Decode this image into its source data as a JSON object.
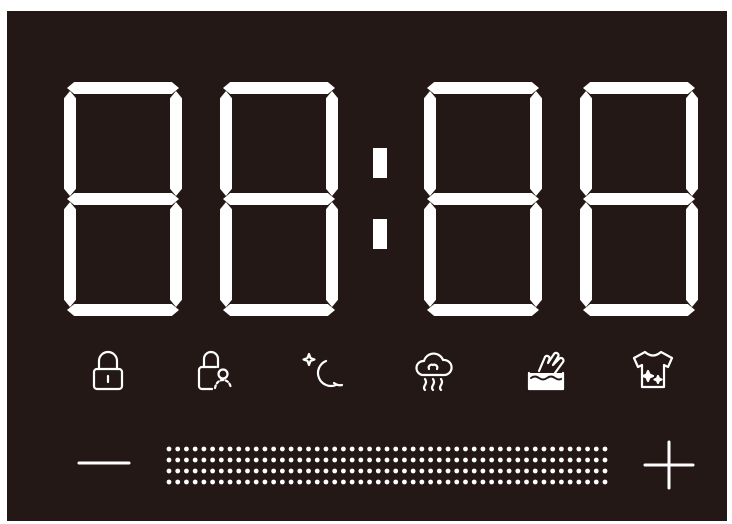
{
  "display": {
    "type": "seven-segment-clock",
    "digits": [
      "8",
      "8",
      "8",
      "8"
    ],
    "colon": true,
    "segment_color": "#ffffff",
    "background_color": "#231815"
  },
  "buttons": [
    {
      "name": "lock-button",
      "icon": "padlock-icon"
    },
    {
      "name": "child-lock-button",
      "icon": "child-lock-icon"
    },
    {
      "name": "night-mode-button",
      "icon": "moon-stars-icon"
    },
    {
      "name": "rain-mode-button",
      "icon": "cloud-rain-icon"
    },
    {
      "name": "hand-wash-button",
      "icon": "hand-wash-icon"
    },
    {
      "name": "clothes-button",
      "icon": "tshirt-sparkle-icon"
    }
  ],
  "level_control": {
    "decrease_icon": "minus-icon",
    "increase_icon": "plus-icon",
    "indicator": "dot-matrix-bar",
    "dot_rows": 4,
    "dot_columns": 51
  }
}
